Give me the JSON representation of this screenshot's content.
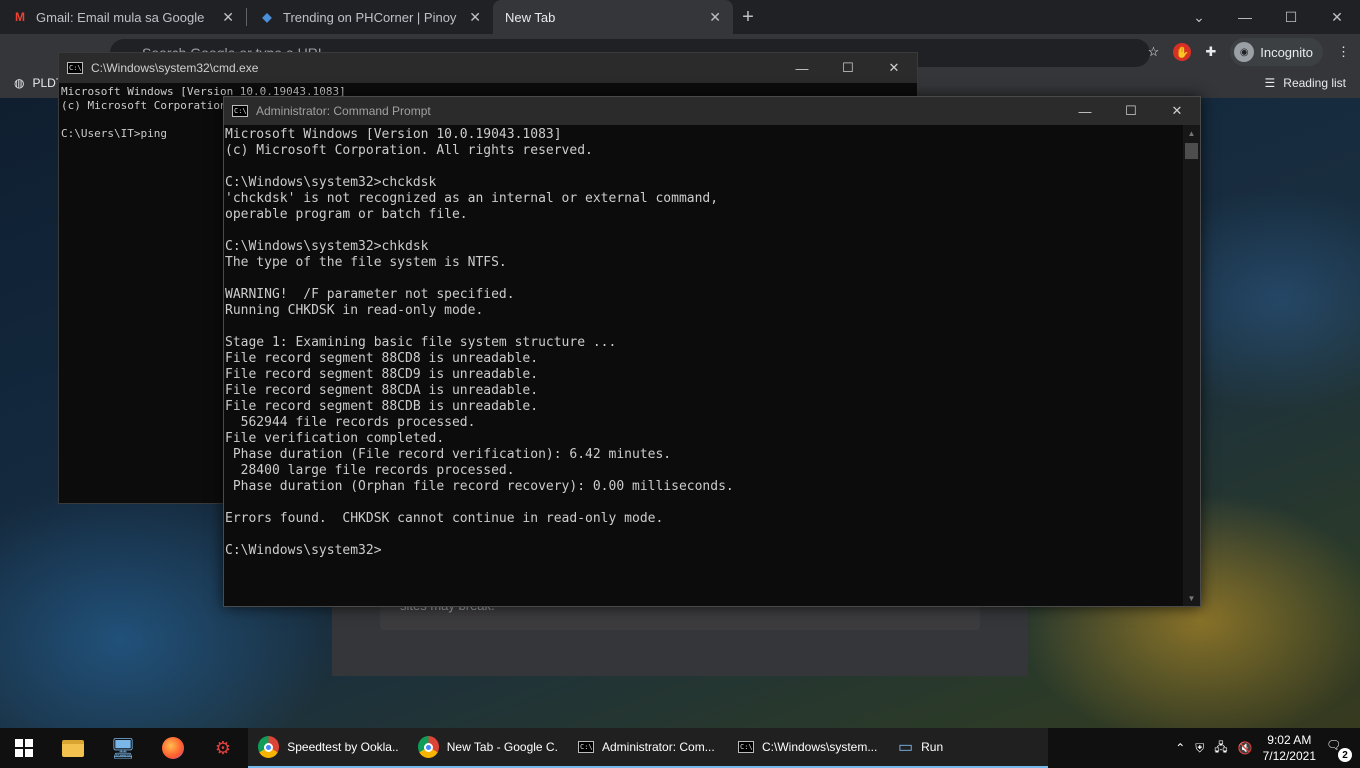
{
  "chrome": {
    "tabs": [
      {
        "title": "Gmail: Email mula sa Google",
        "favicon": "M",
        "close": "✕"
      },
      {
        "title": "Trending on PHCorner | Pinoy In",
        "favicon": "◆",
        "close": "✕"
      },
      {
        "title": "New Tab",
        "close": "✕"
      }
    ],
    "new_tab": "+",
    "omnibox_placeholder": "Search Google or type a URL",
    "incognito_label": "Incognito",
    "bookmark": "PLDT",
    "reading_list": "Reading list",
    "page_card_text": "sites may break."
  },
  "cmd_background": {
    "title": "C:\\Windows\\system32\\cmd.exe",
    "text": "Microsoft Windows [Version 10.0.19043.1083]\n(c) Microsoft Corporation. All rights reserved.\n\nC:\\Users\\IT>ping"
  },
  "cmd_admin": {
    "title": "Administrator: Command Prompt",
    "text": "Microsoft Windows [Version 10.0.19043.1083]\n(c) Microsoft Corporation. All rights reserved.\n\nC:\\Windows\\system32>chckdsk\n'chckdsk' is not recognized as an internal or external command,\noperable program or batch file.\n\nC:\\Windows\\system32>chkdsk\nThe type of the file system is NTFS.\n\nWARNING!  /F parameter not specified.\nRunning CHKDSK in read-only mode.\n\nStage 1: Examining basic file system structure ...\nFile record segment 88CD8 is unreadable.\nFile record segment 88CD9 is unreadable.\nFile record segment 88CDA is unreadable.\nFile record segment 88CDB is unreadable.\n  562944 file records processed.\nFile verification completed.\n Phase duration (File record verification): 6.42 minutes.\n  28400 large file records processed.\n Phase duration (Orphan file record recovery): 0.00 milliseconds.\n\nErrors found.  CHKDSK cannot continue in read-only mode.\n\nC:\\Windows\\system32>"
  },
  "window_controls": {
    "minimize": "—",
    "maximize": "☐",
    "close": "✕"
  },
  "taskbar": {
    "apps": [
      {
        "label": "Speedtest by Ookla..."
      },
      {
        "label": "New Tab - Google C..."
      },
      {
        "label": "Administrator: Com..."
      },
      {
        "label": "C:\\Windows\\system..."
      },
      {
        "label": "Run"
      }
    ],
    "time": "9:02 AM",
    "date": "7/12/2021",
    "notifications": "2"
  },
  "colors": {
    "accent": "#76b9ed",
    "console_bg": "#0c0c0c",
    "console_fg": "#cccccc"
  }
}
